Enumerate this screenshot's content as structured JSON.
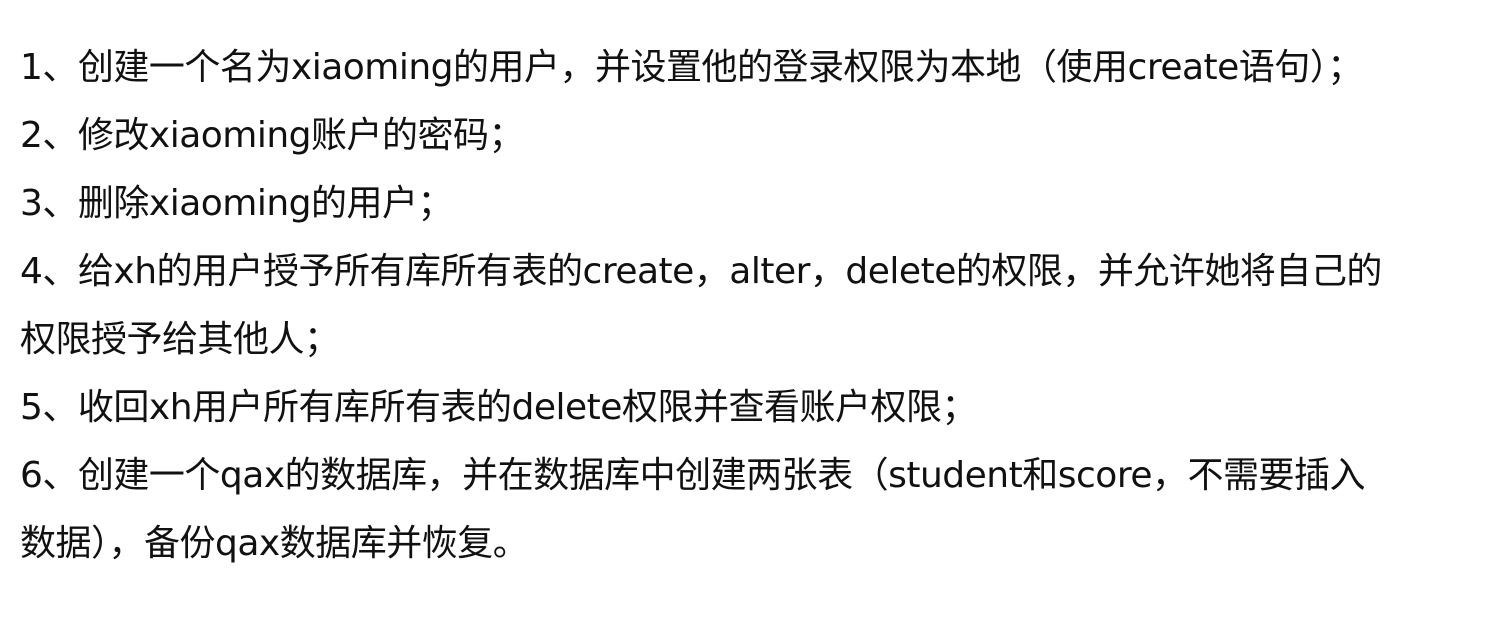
{
  "document": {
    "lines": [
      "1、创建一个名为xiaoming的用户，并设置他的登录权限为本地（使用create语句）；",
      "2、修改xiaoming账户的密码；",
      "3、删除xiaoming的用户；",
      "4、给xh的用户授予所有库所有表的create，alter，delete的权限，并允许她将自己的",
      "权限授予给其他人；",
      "5、收回xh用户所有库所有表的delete权限并查看账户权限；",
      "6、创建一个qax的数据库，并在数据库中创建两张表（student和score，不需要插入",
      "数据），备份qax数据库并恢复。"
    ]
  }
}
